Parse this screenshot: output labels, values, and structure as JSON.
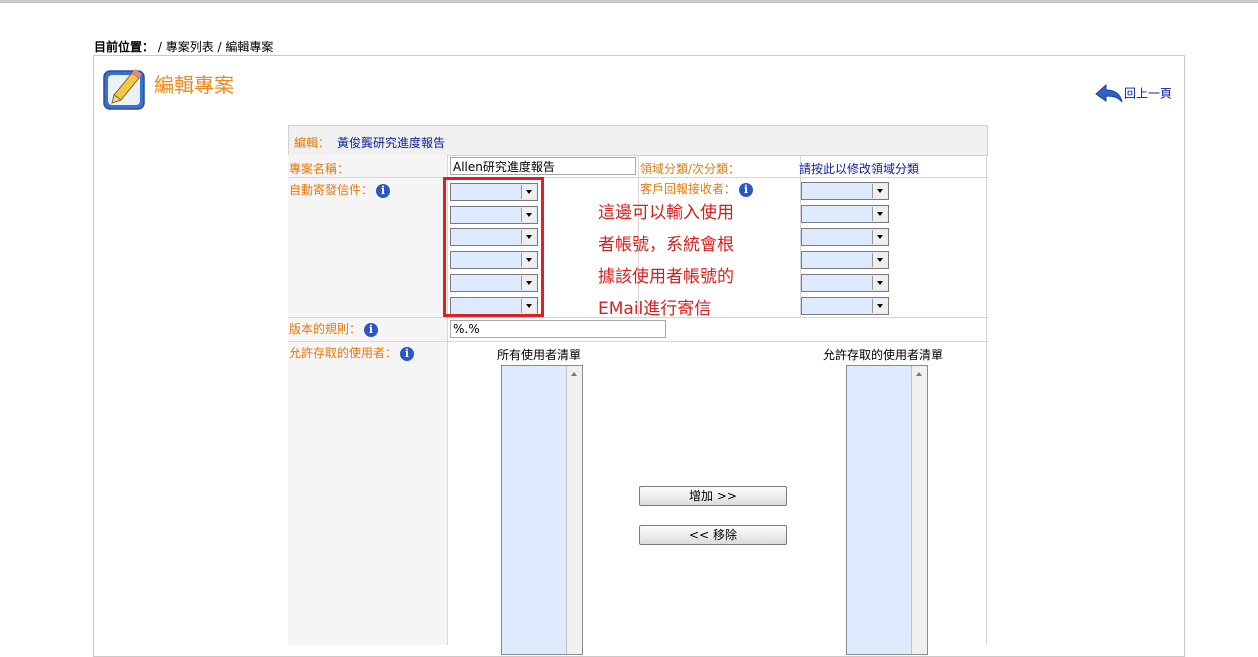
{
  "breadcrumb": {
    "prefix": "目前位置：",
    "path": "/ 專案列表 / 編輯專案"
  },
  "page": {
    "title": "編輯專案",
    "back_label": "回上一頁"
  },
  "form": {
    "edit_label": "編輯：",
    "edit_value": "黃俊龔研究進度報告",
    "project_name_label": "專案名稱：",
    "project_name_value": "Allen研究進度報告",
    "domain_label": "領域分類/次分類：",
    "domain_link": "請按此以修改領域分類",
    "auto_mail_label": "自動寄發信件：",
    "client_receiver_label": "客戶回報接收者：",
    "version_rule_label": "版本的規則：",
    "version_rule_value": "%.%",
    "allowed_users_label": "允許存取的使用者：",
    "all_users_caption": "所有使用者清單",
    "allowed_users_caption": "允許存取的使用者清單",
    "add_button": "增加 >>",
    "remove_button": "<< 移除"
  },
  "annotation": {
    "lines": [
      "這邊可以輸入使用",
      "者帳號，系統會根",
      "據該使用者帳號的",
      "EMail進行寄信"
    ]
  },
  "colors": {
    "label_orange": "#e37b0f",
    "link_navy": "#0c1f93",
    "annotation_red": "#d62020"
  }
}
